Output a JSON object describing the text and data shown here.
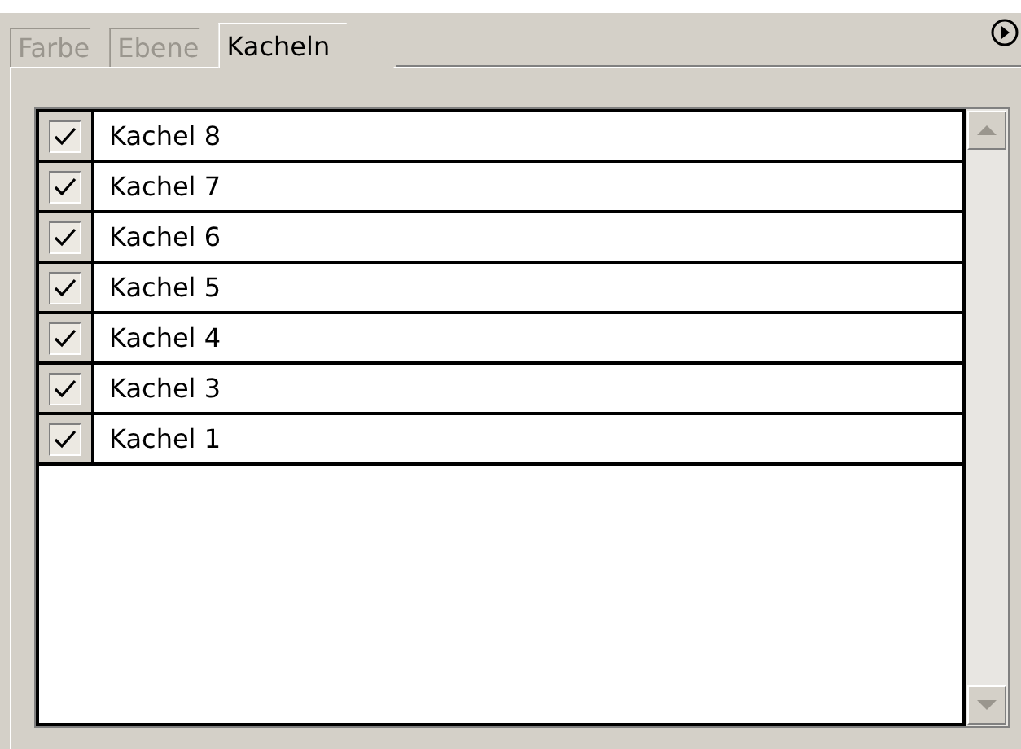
{
  "tabs": [
    {
      "label": "Farbe",
      "selected": false
    },
    {
      "label": "Ebene",
      "selected": false
    },
    {
      "label": "Kacheln",
      "selected": true
    }
  ],
  "layers": [
    {
      "name": "Kachel 8",
      "checked": true
    },
    {
      "name": "Kachel 7",
      "checked": true
    },
    {
      "name": "Kachel 6",
      "checked": true
    },
    {
      "name": "Kachel 5",
      "checked": true
    },
    {
      "name": "Kachel 4",
      "checked": true
    },
    {
      "name": "Kachel 3",
      "checked": true
    },
    {
      "name": "Kachel 1",
      "checked": true
    }
  ]
}
